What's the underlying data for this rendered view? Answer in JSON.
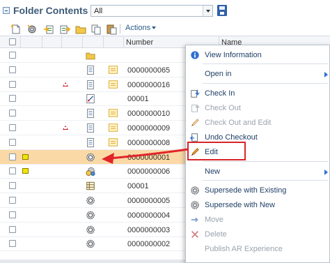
{
  "header": {
    "title": "Folder Contents",
    "filter_value": "All"
  },
  "toolbar": {
    "icons": [
      "new-document-icon",
      "settings-gear-icon",
      "import-icon",
      "export-icon",
      "folder-icon",
      "copy-icon",
      "paste-icon"
    ],
    "actions_label": "Actions"
  },
  "grid": {
    "columns": {
      "number": "Number",
      "name": "Name"
    },
    "rows": [
      {
        "number": "",
        "type": "folder",
        "locked": false,
        "warn": false,
        "status": false,
        "selected": false
      },
      {
        "number": "0000000065",
        "type": "document",
        "locked": false,
        "warn": false,
        "status": true,
        "selected": false
      },
      {
        "number": "0000000016",
        "type": "document",
        "locked": false,
        "warn": true,
        "status": true,
        "selected": false
      },
      {
        "number": "00001",
        "type": "drawing",
        "locked": false,
        "warn": false,
        "status": false,
        "selected": false
      },
      {
        "number": "0000000010",
        "type": "document",
        "locked": false,
        "warn": false,
        "status": true,
        "selected": false
      },
      {
        "number": "0000000009",
        "type": "document",
        "locked": false,
        "warn": true,
        "status": true,
        "selected": false
      },
      {
        "number": "0000000008",
        "type": "document",
        "locked": false,
        "warn": false,
        "status": true,
        "selected": false
      },
      {
        "number": "0000000001",
        "type": "part",
        "locked": true,
        "warn": false,
        "status": false,
        "selected": true
      },
      {
        "number": "0000000006",
        "type": "assembly",
        "locked": true,
        "warn": false,
        "status": false,
        "selected": false
      },
      {
        "number": "00001",
        "type": "table",
        "locked": false,
        "warn": false,
        "status": false,
        "selected": false
      },
      {
        "number": "0000000005",
        "type": "part",
        "locked": false,
        "warn": false,
        "status": false,
        "selected": false
      },
      {
        "number": "0000000004",
        "type": "part",
        "locked": false,
        "warn": false,
        "status": false,
        "selected": false
      },
      {
        "number": "0000000003",
        "type": "part",
        "locked": false,
        "warn": false,
        "status": false,
        "selected": false
      },
      {
        "number": "0000000002",
        "type": "part",
        "locked": false,
        "warn": false,
        "status": false,
        "selected": false
      }
    ]
  },
  "context_menu": {
    "items": [
      {
        "label": "View Information",
        "icon": "info-icon",
        "disabled": false,
        "submenu": false
      },
      {
        "label": "Open in",
        "icon": "",
        "disabled": false,
        "submenu": true
      },
      {
        "label": "Check In",
        "icon": "check-in-icon",
        "disabled": false,
        "submenu": false
      },
      {
        "label": "Check Out",
        "icon": "check-out-icon",
        "disabled": true,
        "submenu": false
      },
      {
        "label": "Check Out and Edit",
        "icon": "pencil-icon",
        "disabled": true,
        "submenu": false
      },
      {
        "label": "Undo Checkout",
        "icon": "undo-checkout-icon",
        "disabled": false,
        "submenu": false
      },
      {
        "label": "Edit",
        "icon": "pencil-icon",
        "disabled": false,
        "submenu": false,
        "highlighted": true
      },
      {
        "label": "New",
        "icon": "",
        "disabled": false,
        "submenu": true
      },
      {
        "label": "Supersede with Existing",
        "icon": "gear-icon",
        "disabled": false,
        "submenu": false
      },
      {
        "label": "Supersede with New",
        "icon": "gear-icon",
        "disabled": false,
        "submenu": false
      },
      {
        "label": "Move",
        "icon": "move-arrow-icon",
        "disabled": true,
        "submenu": false
      },
      {
        "label": "Delete",
        "icon": "delete-x-icon",
        "disabled": true,
        "submenu": false
      },
      {
        "label": "Publish AR Experience",
        "icon": "",
        "disabled": true,
        "submenu": false
      }
    ]
  },
  "colors": {
    "accent": "#2b5a8a",
    "selected_row": "#fbd9a6",
    "highlight_box": "#d9242a",
    "annotation_arrow": "#e0242a"
  }
}
